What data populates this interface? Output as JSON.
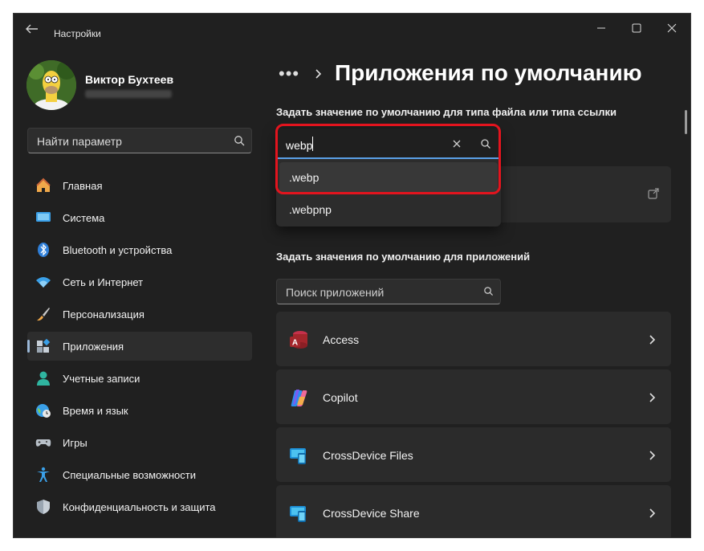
{
  "window": {
    "title": "Настройки"
  },
  "profile": {
    "name": "Виктор Бухтеев"
  },
  "sidebar_search": {
    "placeholder": "Найти параметр"
  },
  "nav": [
    {
      "label": "Главная",
      "icon": "home-icon"
    },
    {
      "label": "Система",
      "icon": "system-icon"
    },
    {
      "label": "Bluetooth и устройства",
      "icon": "bluetooth-icon"
    },
    {
      "label": "Сеть и Интернет",
      "icon": "wifi-icon"
    },
    {
      "label": "Персонализация",
      "icon": "brush-icon"
    },
    {
      "label": "Приложения",
      "icon": "apps-icon",
      "active": true
    },
    {
      "label": "Учетные записи",
      "icon": "user-icon"
    },
    {
      "label": "Время и язык",
      "icon": "globe-clock-icon"
    },
    {
      "label": "Игры",
      "icon": "gamepad-icon"
    },
    {
      "label": "Специальные возможности",
      "icon": "accessibility-icon"
    },
    {
      "label": "Конфиденциальность и защита",
      "icon": "shield-icon"
    }
  ],
  "breadcrumb": {
    "more": "•••",
    "title": "Приложения по умолчанию"
  },
  "filetype_section": {
    "label": "Задать значение по умолчанию для типа файла или типа ссылки",
    "search_value": "webp",
    "suggestions": [
      ".webp",
      ".webpnp"
    ]
  },
  "apps_section": {
    "label": "Задать значения по умолчанию для приложений",
    "search_placeholder": "Поиск приложений",
    "apps": [
      {
        "name": "Access",
        "icon": "access-icon"
      },
      {
        "name": "Copilot",
        "icon": "copilot-icon"
      },
      {
        "name": "CrossDevice Files",
        "icon": "crossdevice-icon"
      },
      {
        "name": "CrossDevice Share",
        "icon": "crossdevice-icon"
      }
    ]
  },
  "colors": {
    "accent": "#5aa0e6",
    "highlight": "#e3141e",
    "background": "#202020"
  }
}
